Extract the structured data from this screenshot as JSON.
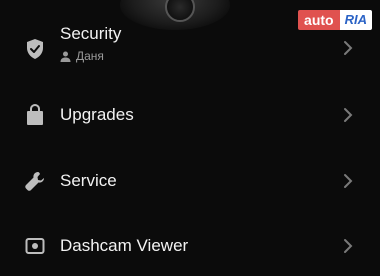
{
  "watermark": {
    "auto": "auto",
    "ria": "RIA"
  },
  "menu": {
    "items": [
      {
        "label": "Security",
        "sublabel": "Даня",
        "icon": "shield-check-icon"
      },
      {
        "label": "Upgrades",
        "icon": "shopping-bag-icon"
      },
      {
        "label": "Service",
        "icon": "wrench-icon"
      },
      {
        "label": "Dashcam Viewer",
        "icon": "camera-viewer-icon"
      }
    ]
  },
  "colors": {
    "background": "#0b0b0b",
    "text": "#f2f2f2",
    "muted": "#9a9a9a",
    "chevron": "#7a7a7a"
  }
}
